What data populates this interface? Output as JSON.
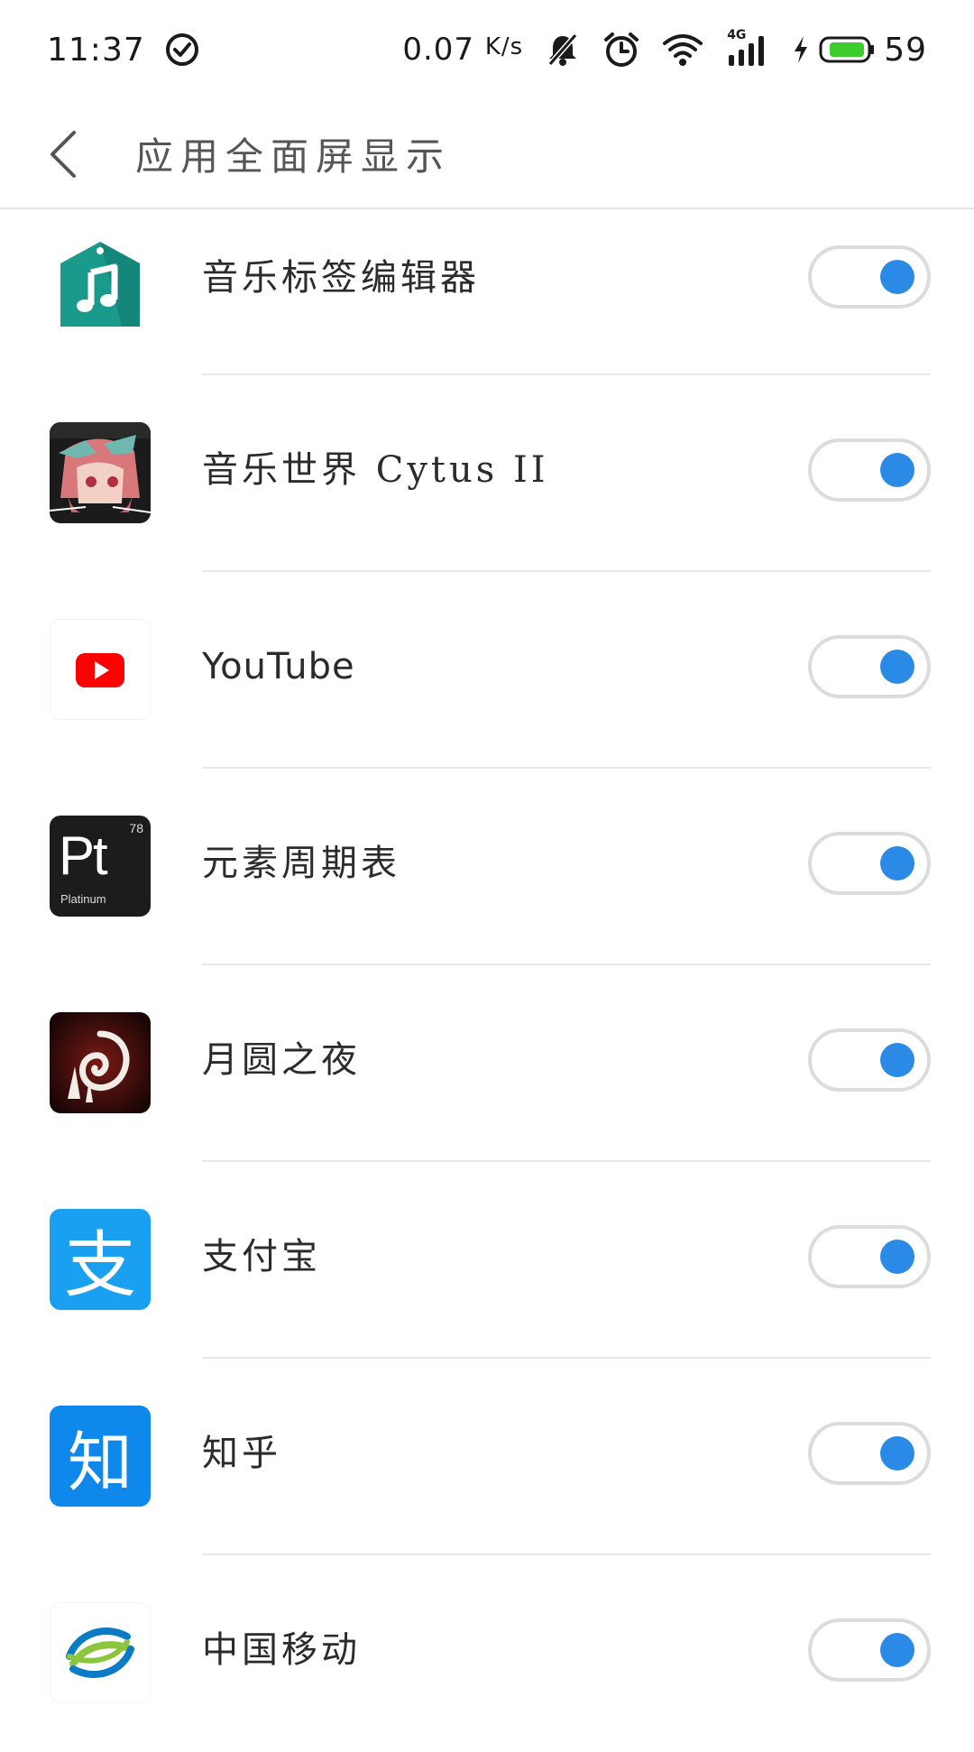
{
  "status_bar": {
    "time": "11:37",
    "net_speed_value": "0.07",
    "net_speed_unit": "K/s",
    "network_label": "4G",
    "battery_level": "59"
  },
  "header": {
    "title": "应用全面屏显示"
  },
  "apps": [
    {
      "name": "音乐标签编辑器",
      "enabled": true
    },
    {
      "name": "音乐世界 Cytus II",
      "enabled": true
    },
    {
      "name": "YouTube",
      "enabled": true
    },
    {
      "name": "元素周期表",
      "enabled": true,
      "icon_symbol": "Pt",
      "icon_number": "78",
      "icon_label": "Platinum"
    },
    {
      "name": "月圆之夜",
      "enabled": true
    },
    {
      "name": "支付宝",
      "enabled": true,
      "icon_glyph": "支"
    },
    {
      "name": "知乎",
      "enabled": true,
      "icon_glyph": "知"
    },
    {
      "name": "中国移动",
      "enabled": true
    }
  ],
  "colors": {
    "toggle_on": "#2b8ae6",
    "alipay_blue": "#1aa0f0",
    "zhihu_blue": "#0f88eb",
    "music_tag_green": "#1a9a8a",
    "youtube_red": "#ff0000",
    "battery_green": "#3dcc2e"
  }
}
